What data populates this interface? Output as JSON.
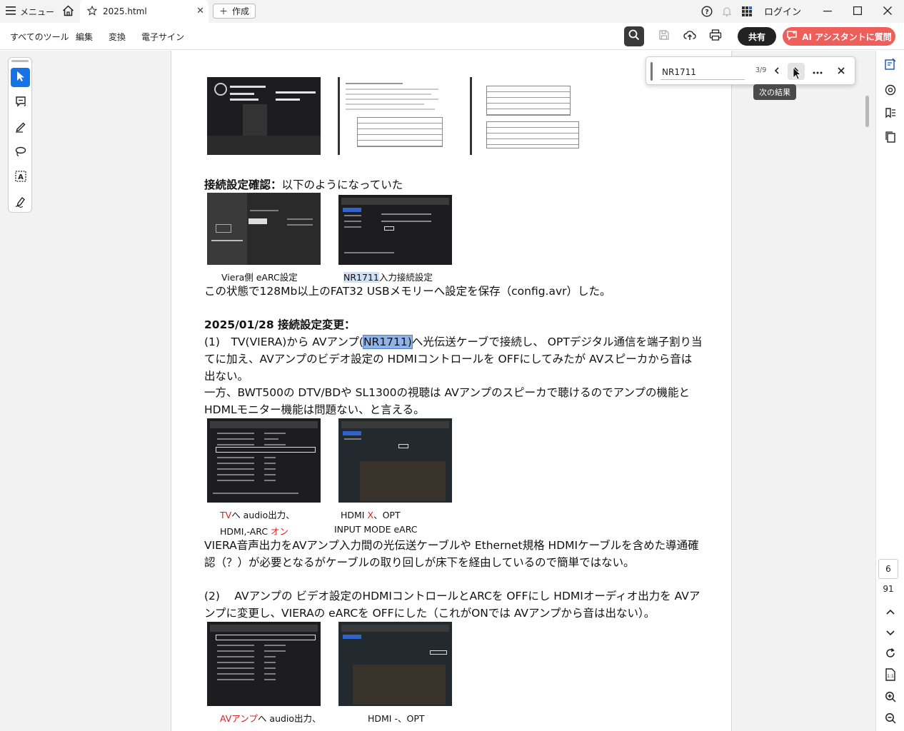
{
  "tabbar": {
    "menu_label": "メニュー",
    "tab_title": "2025.html",
    "new_label": "作成",
    "login_label": "ログイン"
  },
  "toolbar": {
    "menus": [
      "すべてのツール",
      "編集",
      "変換",
      "電子サイン"
    ],
    "share_label": "共有",
    "ai_label": "AI アシスタントに質問"
  },
  "find": {
    "query": "NR1711",
    "count": "3/9",
    "tooltip": "次の結果"
  },
  "page_nav": {
    "current": "6",
    "total": "91"
  },
  "doc": {
    "section1_label": "接続設定確認：",
    "section1_text": "以下のようになっていた",
    "cap_viera": "Viera側 eARC設定",
    "cap_nr_hl": "NR1711",
    "cap_nr_rest": "入力接続設定",
    "para_saved": "この状態で128Mb以上のFAT32 USBメモリーへ設定を保存（config.avr）した。",
    "section2_heading": "2025/01/28 接続設定変更：",
    "p1_pre": "(1)　TV(VIERA)から AVアンプ(",
    "p1_hl": "NR1711)",
    "p1_post": "へ光伝送ケーブで接続し、 OPTデジタル通信を端子割り当",
    "p1_line2": "てに加え、AVアンプのビデオ設定の HDMIコントロールを OFFにしてみたが AVスピーカから音は",
    "p1_line3": "出ない。",
    "p2_line1": "一方、BWT500の DTV/BDや SL1300の視聴は AVアンプのスピーカで聴けるのでアンプの機能と",
    "p2_line2": "HDMLモニター機能は問題ない、と言える。",
    "cap2a_red": "TV",
    "cap2a_rest": "へ audio出力、",
    "cap2b_pre": "HDMI,-ARC ",
    "cap2b_red": "オン",
    "cap2c_pre": "HDMI ",
    "cap2c_red": "X",
    "cap2c_post": "、OPT",
    "cap2d": "INPUT MODE eARC",
    "p3_line1": "VIERA音声出力をAVアンプ入力間の光伝送ケーブルや Ethernet規格 HDMIケーブルを含めた導通確",
    "p3_line2": "認（？）が必要となるがケーブルの取り回しが床下を経由しているので簡単ではない。",
    "p4_line1": "(2)　 AVアンプの ビデオ設定のHDMIコントロールとARCを OFFにし HDMIオーディオ出力を AVア",
    "p4_line2": "ンプに変更し、VIERAの eARCを OFFにした（これがONでは AVアンプから音は出ない）。",
    "cap3a_red": "AVアンプ",
    "cap3a_rest": "へ audio出力、",
    "cap3b": "HDMI -、OPT"
  }
}
